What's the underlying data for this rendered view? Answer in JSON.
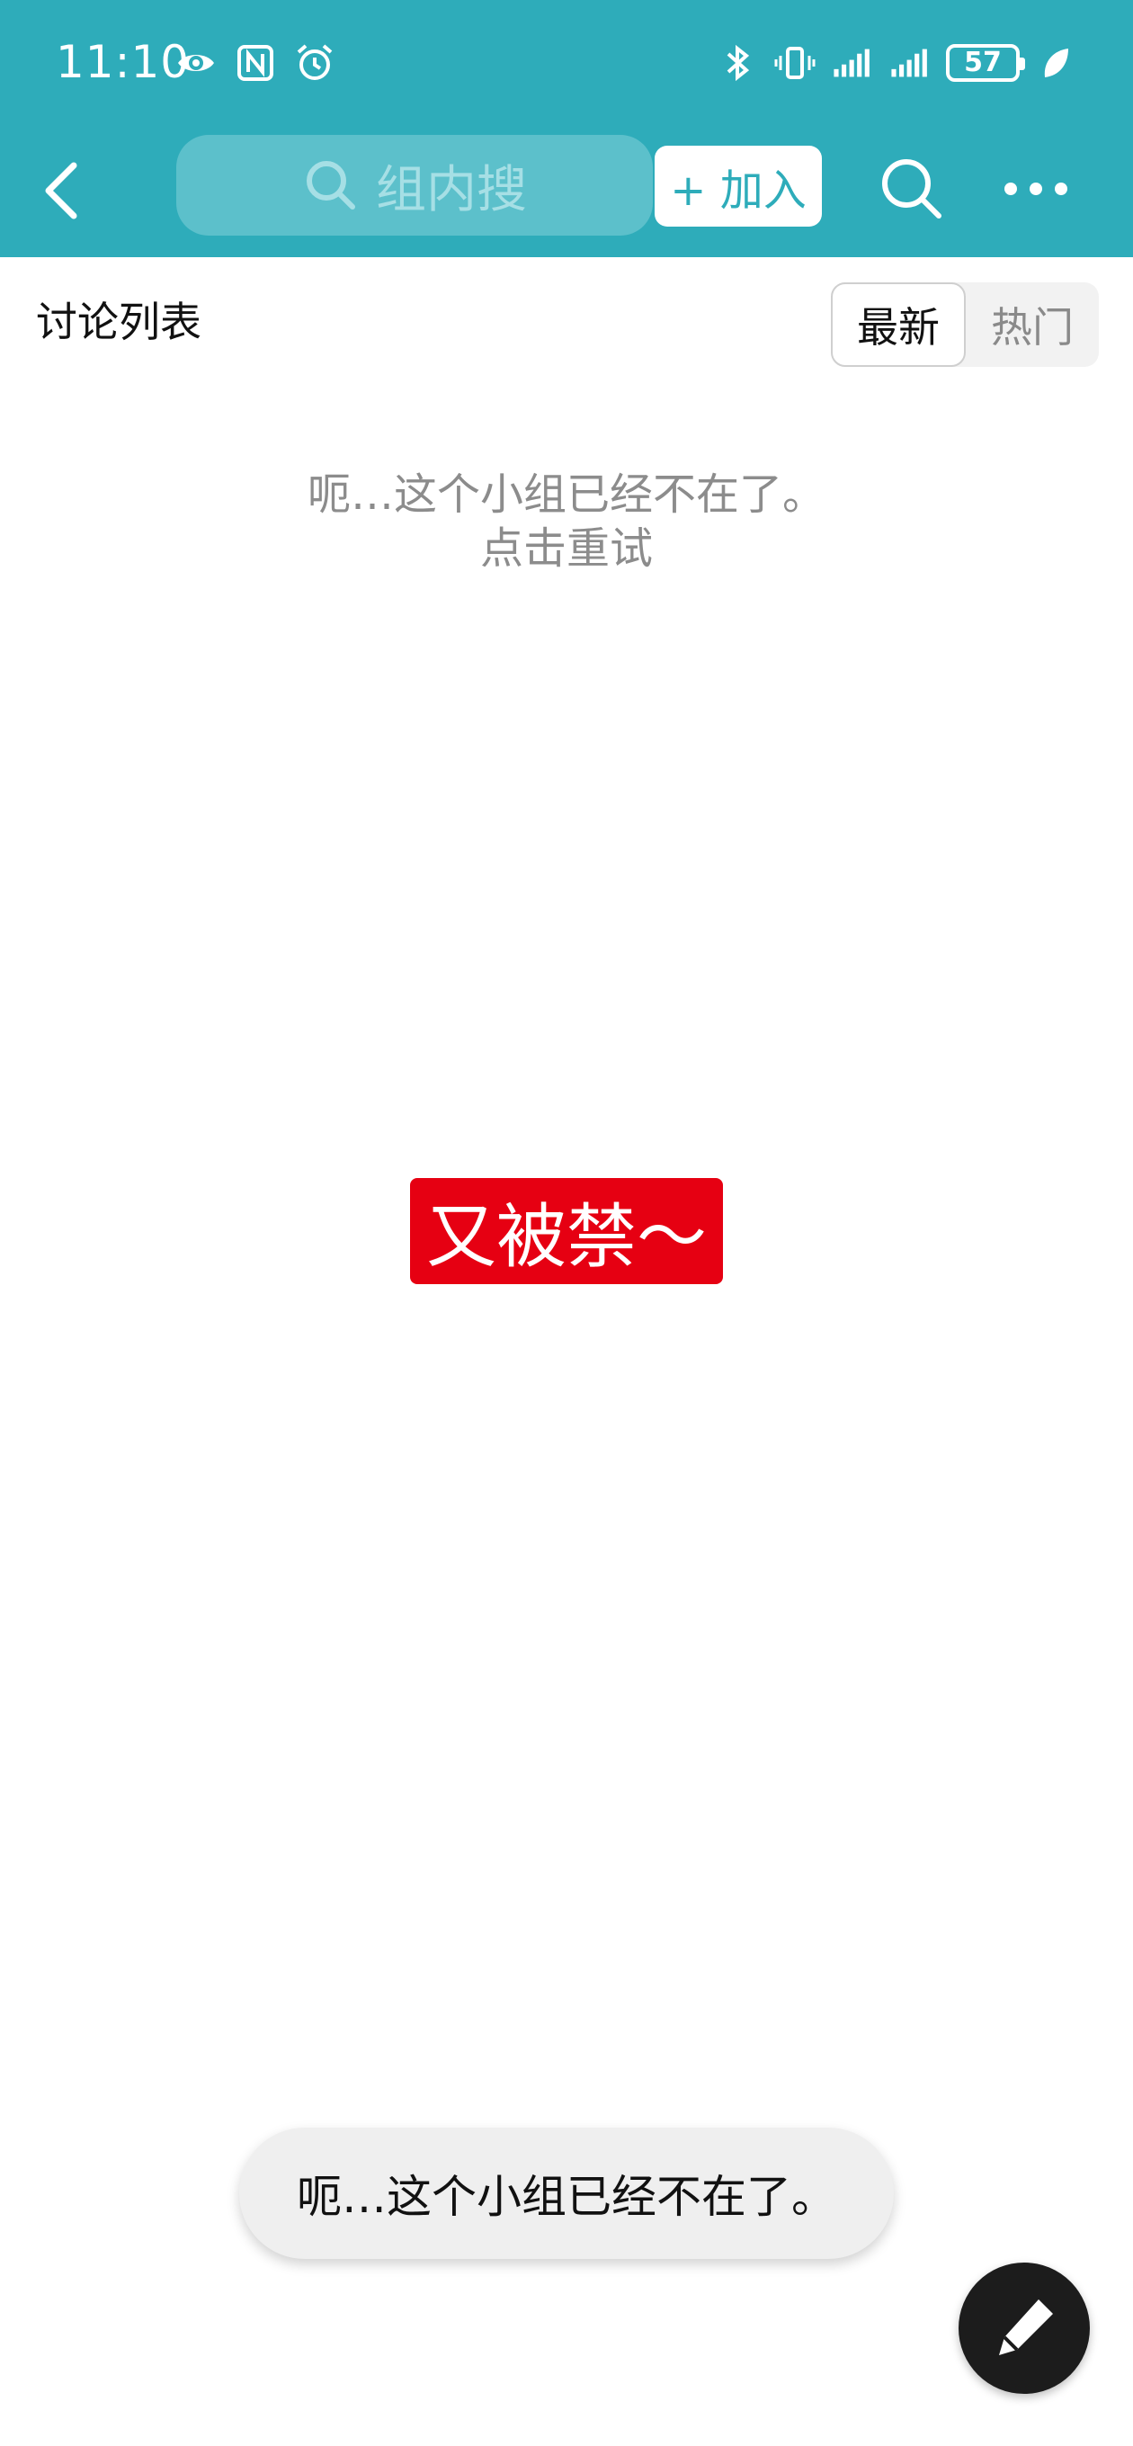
{
  "status_bar": {
    "time": "11:10",
    "battery": "57",
    "icons_left": [
      "eye-icon",
      "nfc-icon",
      "alarm-icon"
    ],
    "icons_right": [
      "bluetooth-icon",
      "vibrate-icon",
      "signal-icon",
      "signal-icon",
      "battery-icon",
      "leaf-icon"
    ]
  },
  "nav": {
    "search_placeholder": "组内搜",
    "join_label": "+ 加入",
    "icons": [
      "back-icon",
      "search-icon",
      "more-icon"
    ]
  },
  "section": {
    "title": "讨论列表",
    "tabs": [
      {
        "label": "最新",
        "selected": true
      },
      {
        "label": "热门",
        "selected": false
      }
    ]
  },
  "empty_state": {
    "message": "呃…这个小组已经不在了。",
    "retry": "点击重试"
  },
  "sticker": {
    "text": "又被禁～"
  },
  "toast": {
    "text": "呃…这个小组已经不在了。"
  },
  "fab": {
    "icon": "pen-icon"
  },
  "colors": {
    "header": "#2eacba",
    "sticker": "#e60012",
    "fab": "#1c1c1c"
  }
}
